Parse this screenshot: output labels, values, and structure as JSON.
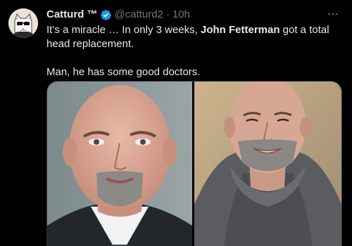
{
  "tweet": {
    "author_name": "Catturd ™",
    "handle": "@catturd2",
    "separator": "·",
    "time": "10h",
    "more_icon": "ellipsis-icon",
    "verified_icon": "verified-badge-icon",
    "text_line1_pre": "It’s a miracle … In only 3 weeks, ",
    "text_line1_bold": "John Fetterman",
    "text_line1_post": " got a total head replacement.",
    "text_line2": "Man, he has some good doctors.",
    "colors": {
      "background": "#000000",
      "text": "#e7e9ea",
      "muted": "#71767b",
      "verified": "#1d9bf0"
    }
  }
}
